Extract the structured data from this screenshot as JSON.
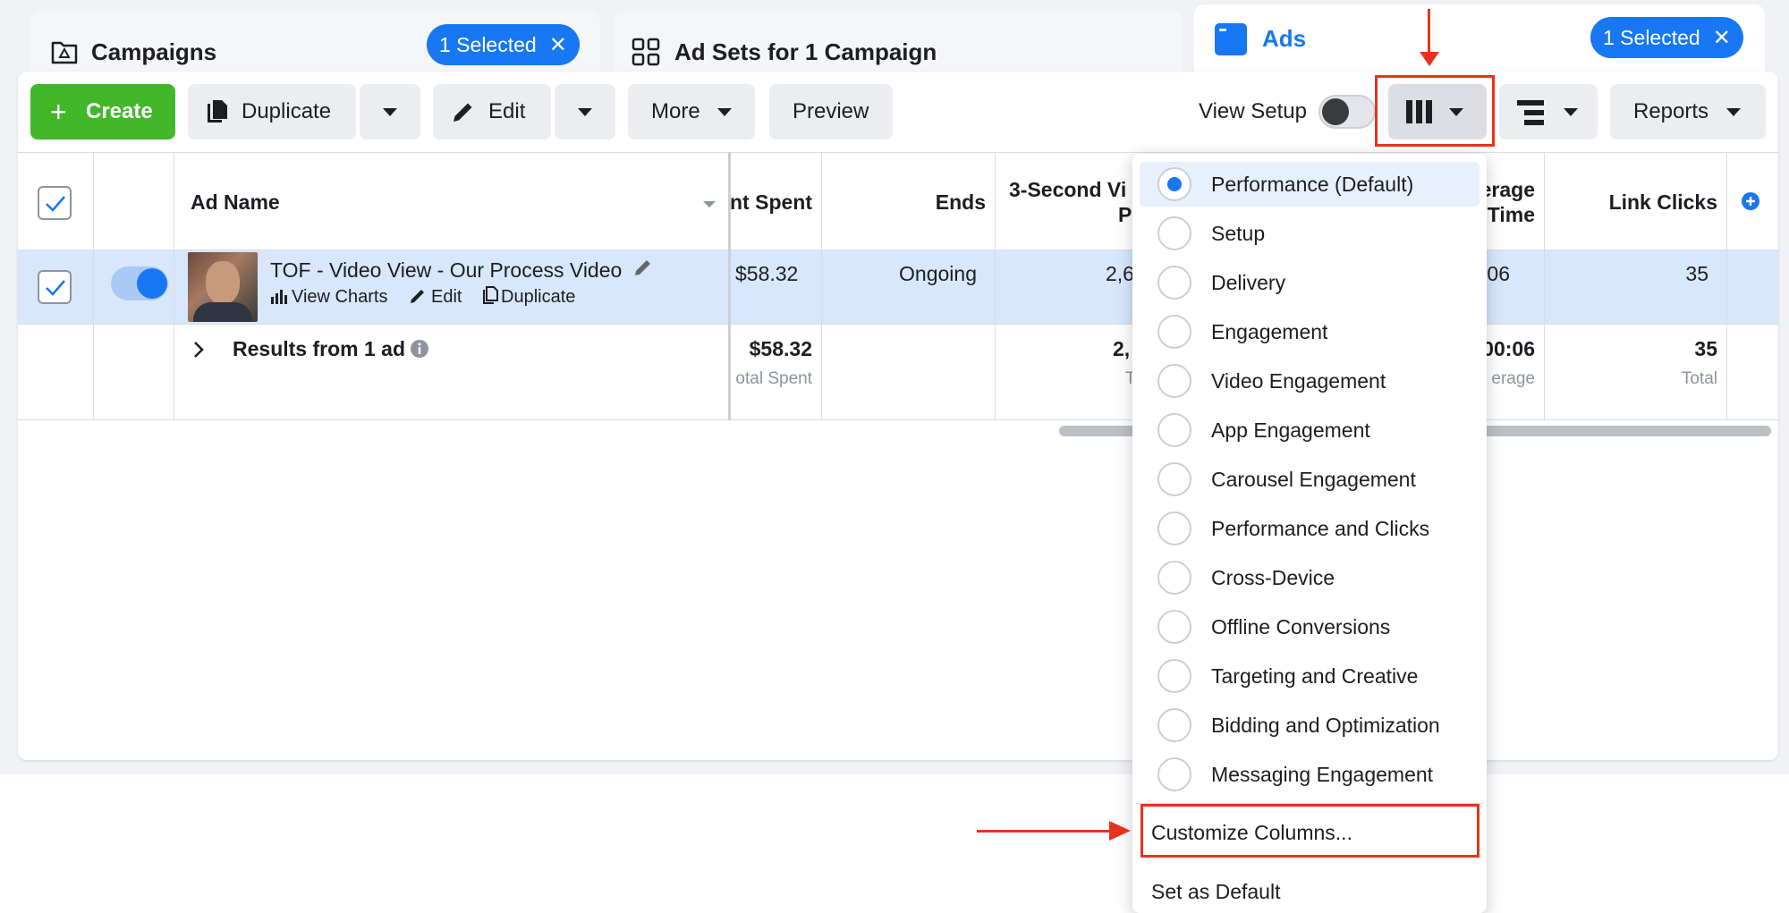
{
  "tabs": {
    "campaigns": {
      "label": "Campaigns",
      "badge": "1 Selected",
      "icon": "folder-icon"
    },
    "adsets": {
      "label": "Ad Sets for 1 Campaign",
      "icon": "grid-icon"
    },
    "ads": {
      "label": "Ads",
      "badge": "1 Selected",
      "icon": "ad-window-icon"
    }
  },
  "toolbar": {
    "create": "Create",
    "duplicate": "Duplicate",
    "edit": "Edit",
    "more": "More",
    "preview": "Preview",
    "view_setup": "View Setup",
    "reports": "Reports"
  },
  "table": {
    "headers": {
      "ad_name": "Ad Name",
      "amount_spent": "nt Spent",
      "ends": "Ends",
      "three_sec_line1": "3-Second Vi",
      "three_sec_line2": "Pl",
      "avg_time_line1": "erage",
      "avg_time_line2": "Time",
      "link_clicks": "Link Clicks"
    },
    "row": {
      "name": "TOF - Video View - Our Process Video",
      "view_charts": "View Charts",
      "edit": "Edit",
      "duplicate": "Duplicate",
      "amount_spent": "$58.32",
      "ends": "Ongoing",
      "three_sec": "2,6",
      "avg_time": "0:06",
      "link_clicks": "35"
    },
    "totals": {
      "label": "Results from 1 ad",
      "amount_spent": "$58.32",
      "amount_spent_sub": "otal Spent",
      "three_sec": "2,",
      "three_sec_sub": "T",
      "avg_time": "00:06",
      "avg_time_sub": "erage",
      "link_clicks": "35",
      "link_clicks_sub": "Total"
    }
  },
  "columns_menu": {
    "items": [
      {
        "label": "Performance (Default)",
        "selected": true
      },
      {
        "label": "Setup",
        "selected": false
      },
      {
        "label": "Delivery",
        "selected": false
      },
      {
        "label": "Engagement",
        "selected": false
      },
      {
        "label": "Video Engagement",
        "selected": false
      },
      {
        "label": "App Engagement",
        "selected": false
      },
      {
        "label": "Carousel Engagement",
        "selected": false
      },
      {
        "label": "Performance and Clicks",
        "selected": false
      },
      {
        "label": "Cross-Device",
        "selected": false
      },
      {
        "label": "Offline Conversions",
        "selected": false
      },
      {
        "label": "Targeting and Creative",
        "selected": false
      },
      {
        "label": "Bidding and Optimization",
        "selected": false
      },
      {
        "label": "Messaging Engagement",
        "selected": false
      }
    ],
    "customize": "Customize Columns...",
    "set_default": "Set as Default"
  },
  "colors": {
    "accent": "#1877f2",
    "create_green": "#42b72a",
    "annotation_red": "#e8321e",
    "selected_row": "#d8e7fc"
  }
}
